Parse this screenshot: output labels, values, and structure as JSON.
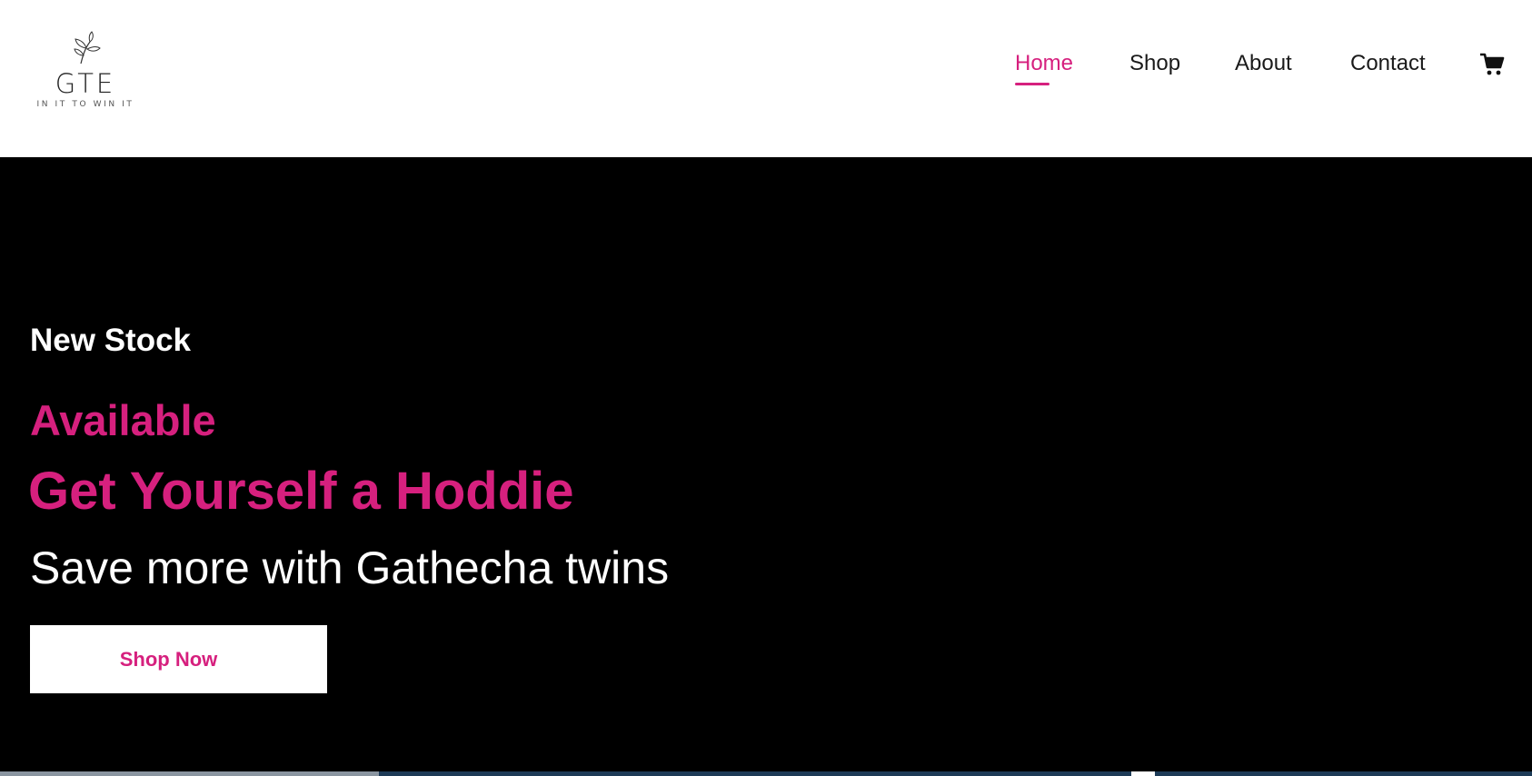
{
  "brand": {
    "logo_name": "GTE",
    "tagline": "IN IT TO WIN IT"
  },
  "nav": {
    "items": [
      {
        "label": "Home",
        "active": true
      },
      {
        "label": "Shop",
        "active": false
      },
      {
        "label": "About",
        "active": false
      },
      {
        "label": "Contact",
        "active": false
      }
    ],
    "cart_icon": "cart-icon"
  },
  "hero": {
    "line1": "New Stock",
    "line2": "Available",
    "headline": "Get Yourself a Hoddie",
    "subheadline": "Save more with Gathecha twins",
    "cta_label": "Shop Now"
  },
  "colors": {
    "accent": "#d6207e",
    "hero_bg": "#000000",
    "text_dark": "#1a1a1a"
  }
}
